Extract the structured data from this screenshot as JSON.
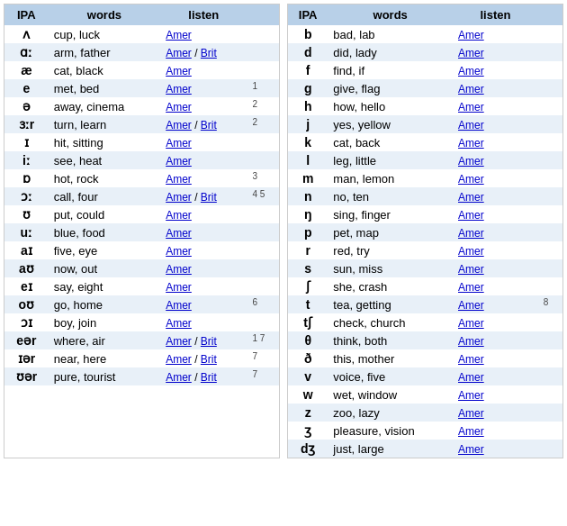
{
  "table1": {
    "headers": [
      "IPA",
      "words",
      "listen"
    ],
    "rows": [
      {
        "ipa": "ʌ",
        "words": "cup, luck",
        "amer": true,
        "brit": false,
        "notes": ""
      },
      {
        "ipa": "ɑː",
        "words": "arm, father",
        "amer": true,
        "brit": true,
        "notes": ""
      },
      {
        "ipa": "æ",
        "words": "cat, black",
        "amer": true,
        "brit": false,
        "notes": ""
      },
      {
        "ipa": "e",
        "words": "met, bed",
        "amer": true,
        "brit": false,
        "notes": "1"
      },
      {
        "ipa": "ə",
        "words": "away, cinema",
        "amer": true,
        "brit": false,
        "notes": "2"
      },
      {
        "ipa": "ɜːr",
        "words": "turn, learn",
        "amer": true,
        "brit": true,
        "notes": "2"
      },
      {
        "ipa": "ɪ",
        "words": "hit, sitting",
        "amer": true,
        "brit": false,
        "notes": ""
      },
      {
        "ipa": "iː",
        "words": "see, heat",
        "amer": true,
        "brit": false,
        "notes": ""
      },
      {
        "ipa": "ɒ",
        "words": "hot, rock",
        "amer": true,
        "brit": false,
        "notes": "3"
      },
      {
        "ipa": "ɔː",
        "words": "call, four",
        "amer": true,
        "brit": true,
        "notes": "4 5"
      },
      {
        "ipa": "ʊ",
        "words": "put, could",
        "amer": true,
        "brit": false,
        "notes": ""
      },
      {
        "ipa": "uː",
        "words": "blue, food",
        "amer": true,
        "brit": false,
        "notes": ""
      },
      {
        "ipa": "aɪ",
        "words": "five, eye",
        "amer": true,
        "brit": false,
        "notes": ""
      },
      {
        "ipa": "aʊ",
        "words": "now, out",
        "amer": true,
        "brit": false,
        "notes": ""
      },
      {
        "ipa": "eɪ",
        "words": "say, eight",
        "amer": true,
        "brit": false,
        "notes": ""
      },
      {
        "ipa": "oʊ",
        "words": "go, home",
        "amer": true,
        "brit": false,
        "notes": "6"
      },
      {
        "ipa": "ɔɪ",
        "words": "boy, join",
        "amer": true,
        "brit": false,
        "notes": ""
      },
      {
        "ipa": "eər",
        "words": "where, air",
        "amer": true,
        "brit": true,
        "notes": "1 7"
      },
      {
        "ipa": "ɪər",
        "words": "near, here",
        "amer": true,
        "brit": true,
        "notes": "7"
      },
      {
        "ipa": "ʊər",
        "words": "pure, tourist",
        "amer": true,
        "brit": true,
        "notes": "7"
      }
    ]
  },
  "table2": {
    "headers": [
      "IPA",
      "words",
      "listen"
    ],
    "rows": [
      {
        "ipa": "b",
        "words": "bad, lab",
        "amer": true,
        "brit": false,
        "notes": ""
      },
      {
        "ipa": "d",
        "words": "did, lady",
        "amer": true,
        "brit": false,
        "notes": ""
      },
      {
        "ipa": "f",
        "words": "find, if",
        "amer": true,
        "brit": false,
        "notes": ""
      },
      {
        "ipa": "g",
        "words": "give, flag",
        "amer": true,
        "brit": false,
        "notes": ""
      },
      {
        "ipa": "h",
        "words": "how, hello",
        "amer": true,
        "brit": false,
        "notes": ""
      },
      {
        "ipa": "j",
        "words": "yes, yellow",
        "amer": true,
        "brit": false,
        "notes": ""
      },
      {
        "ipa": "k",
        "words": "cat, back",
        "amer": true,
        "brit": false,
        "notes": ""
      },
      {
        "ipa": "l",
        "words": "leg, little",
        "amer": true,
        "brit": false,
        "notes": ""
      },
      {
        "ipa": "m",
        "words": "man, lemon",
        "amer": true,
        "brit": false,
        "notes": ""
      },
      {
        "ipa": "n",
        "words": "no, ten",
        "amer": true,
        "brit": false,
        "notes": ""
      },
      {
        "ipa": "ŋ",
        "words": "sing, finger",
        "amer": true,
        "brit": false,
        "notes": ""
      },
      {
        "ipa": "p",
        "words": "pet, map",
        "amer": true,
        "brit": false,
        "notes": ""
      },
      {
        "ipa": "r",
        "words": "red, try",
        "amer": true,
        "brit": false,
        "notes": ""
      },
      {
        "ipa": "s",
        "words": "sun, miss",
        "amer": true,
        "brit": false,
        "notes": ""
      },
      {
        "ipa": "ʃ",
        "words": "she, crash",
        "amer": true,
        "brit": false,
        "notes": ""
      },
      {
        "ipa": "t",
        "words": "tea, getting",
        "amer": true,
        "brit": false,
        "notes": "8"
      },
      {
        "ipa": "tʃ",
        "words": "check, church",
        "amer": true,
        "brit": false,
        "notes": ""
      },
      {
        "ipa": "θ",
        "words": "think, both",
        "amer": true,
        "brit": false,
        "notes": ""
      },
      {
        "ipa": "ð",
        "words": "this, mother",
        "amer": true,
        "brit": false,
        "notes": ""
      },
      {
        "ipa": "v",
        "words": "voice, five",
        "amer": true,
        "brit": false,
        "notes": ""
      },
      {
        "ipa": "w",
        "words": "wet, window",
        "amer": true,
        "brit": false,
        "notes": ""
      },
      {
        "ipa": "z",
        "words": "zoo, lazy",
        "amer": true,
        "brit": false,
        "notes": ""
      },
      {
        "ipa": "ʒ",
        "words": "pleasure, vision",
        "amer": true,
        "brit": false,
        "notes": ""
      },
      {
        "ipa": "dʒ",
        "words": "just, large",
        "amer": true,
        "brit": false,
        "notes": ""
      }
    ]
  },
  "labels": {
    "ipa": "IPA",
    "words": "words",
    "listen": "listen",
    "amer": "Amer",
    "brit": "Brit",
    "slash": " / "
  }
}
